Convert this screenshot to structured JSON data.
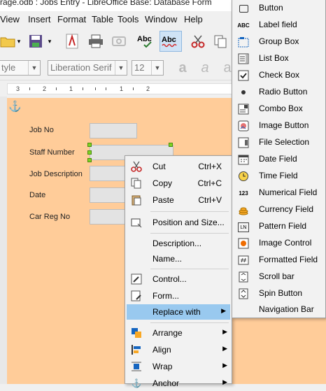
{
  "title_bar": {
    "text": "rage.odb : Jobs Entry - LibreOffice Base: Database Form"
  },
  "menu": [
    {
      "label": "View"
    },
    {
      "label": "Insert"
    },
    {
      "label": "Format"
    },
    {
      "label": "Table"
    },
    {
      "label": "Tools"
    },
    {
      "label": "Window"
    },
    {
      "label": "Help"
    }
  ],
  "formatting": {
    "style_value": "tyle",
    "font_value": "Liberation Serif",
    "size_value": "12"
  },
  "ruler": {
    "numbers": [
      "3",
      "2",
      "1",
      "1",
      "2"
    ]
  },
  "form": {
    "fields": [
      {
        "label": "Job No"
      },
      {
        "label": "Staff Number"
      },
      {
        "label": "Job Description"
      },
      {
        "label": "Date"
      },
      {
        "label": "Car Reg No"
      }
    ]
  },
  "context_menu": {
    "items": [
      {
        "label": "Cut",
        "shortcut": "Ctrl+X",
        "icon": "scissors-icon"
      },
      {
        "label": "Copy",
        "shortcut": "Ctrl+C",
        "icon": "copy-icon"
      },
      {
        "label": "Paste",
        "shortcut": "Ctrl+V",
        "icon": "paste-icon"
      },
      {
        "label": "Position and Size...",
        "icon": "position-size-icon"
      },
      {
        "label": "Description..."
      },
      {
        "label": "Name..."
      },
      {
        "label": "Control...",
        "icon": "control-properties-icon"
      },
      {
        "label": "Form...",
        "icon": "form-properties-icon"
      },
      {
        "label": "Replace with",
        "icon": "none"
      },
      {
        "label": "Arrange",
        "icon": "arrange-icon"
      },
      {
        "label": "Align",
        "icon": "align-icon"
      },
      {
        "label": "Wrap",
        "icon": "wrap-icon"
      },
      {
        "label": "Anchor",
        "icon": "anchor-icon"
      }
    ]
  },
  "replace_submenu": {
    "items": [
      {
        "label": "Button",
        "icon": "button-icon"
      },
      {
        "label": "Label field",
        "icon": "abc-label-icon"
      },
      {
        "label": "Group Box",
        "icon": "group-box-icon"
      },
      {
        "label": "List Box",
        "icon": "list-box-icon"
      },
      {
        "label": "Check Box",
        "icon": "check-box-icon"
      },
      {
        "label": "Radio Button",
        "icon": "radio-button-icon"
      },
      {
        "label": "Combo Box",
        "icon": "combo-box-icon"
      },
      {
        "label": "Image Button",
        "icon": "image-button-icon"
      },
      {
        "label": "File Selection",
        "icon": "file-selection-icon"
      },
      {
        "label": "Date Field",
        "icon": "date-field-icon"
      },
      {
        "label": "Time Field",
        "icon": "time-field-icon"
      },
      {
        "label": "Numerical Field",
        "icon": "numerical-field-icon"
      },
      {
        "label": "Currency Field",
        "icon": "currency-field-icon"
      },
      {
        "label": "Pattern Field",
        "icon": "pattern-field-icon"
      },
      {
        "label": "Image Control",
        "icon": "image-control-icon"
      },
      {
        "label": "Formatted Field",
        "icon": "formatted-field-icon"
      },
      {
        "label": "Scroll bar",
        "icon": "scroll-bar-icon"
      },
      {
        "label": "Spin Button",
        "icon": "spin-button-icon"
      },
      {
        "label": "Navigation Bar",
        "icon": "none"
      }
    ],
    "abc_glyph": "ABC",
    "num_glyph": "123",
    "ln_glyph": "LN"
  },
  "colors": {
    "form_background": "#ffcc99",
    "highlight": "#99c9ef",
    "handle": "#7ed321"
  }
}
